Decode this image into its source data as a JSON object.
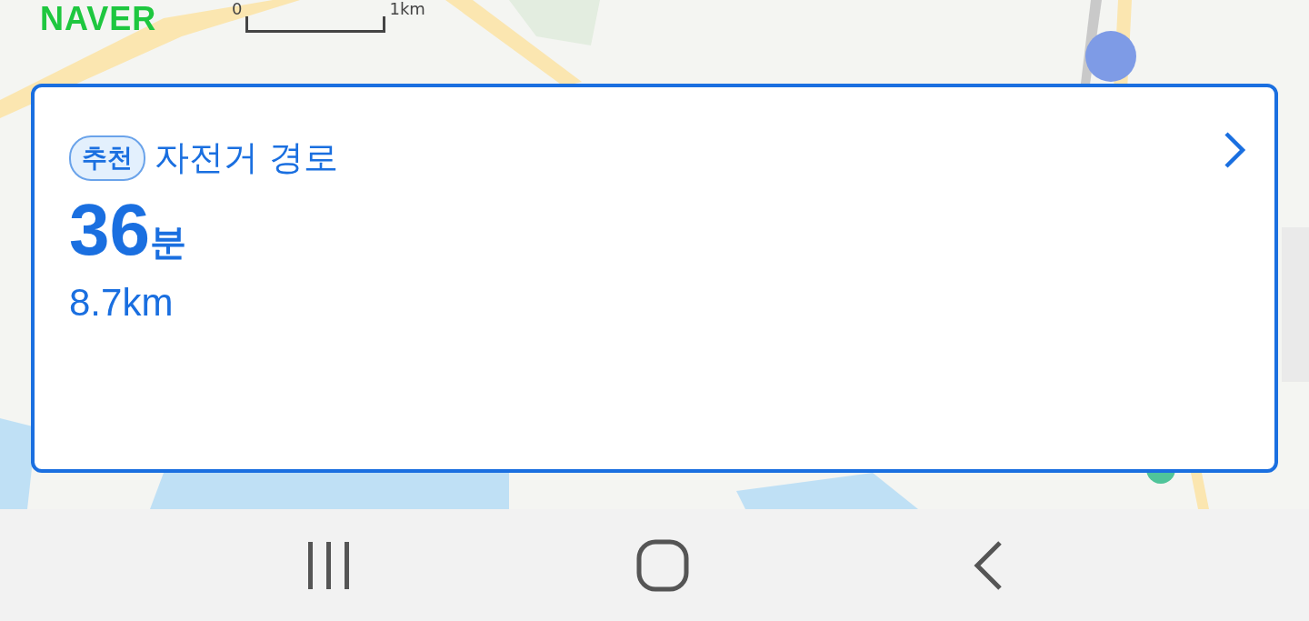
{
  "map": {
    "kind": "picture",
    "logo": "NAVER",
    "scale": {
      "start": "0",
      "end": "1km"
    }
  },
  "route_card": {
    "badge": "추천",
    "title": "자전거 경로",
    "duration_value": "36",
    "duration_unit": "분",
    "distance": "8.7km"
  },
  "nav_bar": {
    "buttons": [
      {
        "kind": "recents"
      },
      {
        "kind": "home"
      },
      {
        "kind": "back"
      }
    ]
  }
}
